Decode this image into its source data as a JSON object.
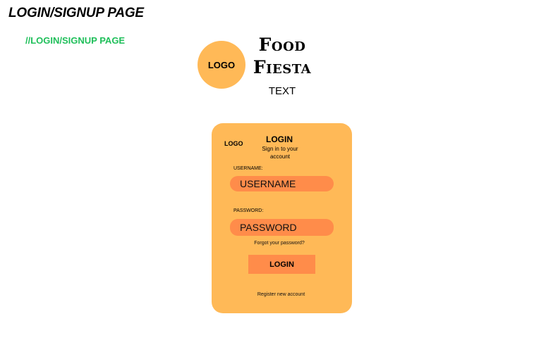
{
  "page": {
    "heading": "LOGIN/SIGNUP PAGE",
    "comment": "//LOGIN/SIGNUP PAGE"
  },
  "brand": {
    "logo_text": "LOGO",
    "name_line1": "Food",
    "name_line2": "Fiesta",
    "tagline": "TEXT"
  },
  "card": {
    "logo_text": "LOGO",
    "title": "LOGIN",
    "subtitle": "Sign in to your account",
    "username_label": "USERNAME:",
    "username_placeholder": "USERNAME",
    "password_label": "PASSWORD:",
    "password_placeholder": "PASSWORD",
    "forgot_text": "Forgot your password?",
    "login_button": "LOGIN",
    "register_text": "Register new account"
  },
  "colors": {
    "accent": "#ffb957",
    "input": "#ff8c4a",
    "comment": "#1fbf5a"
  }
}
